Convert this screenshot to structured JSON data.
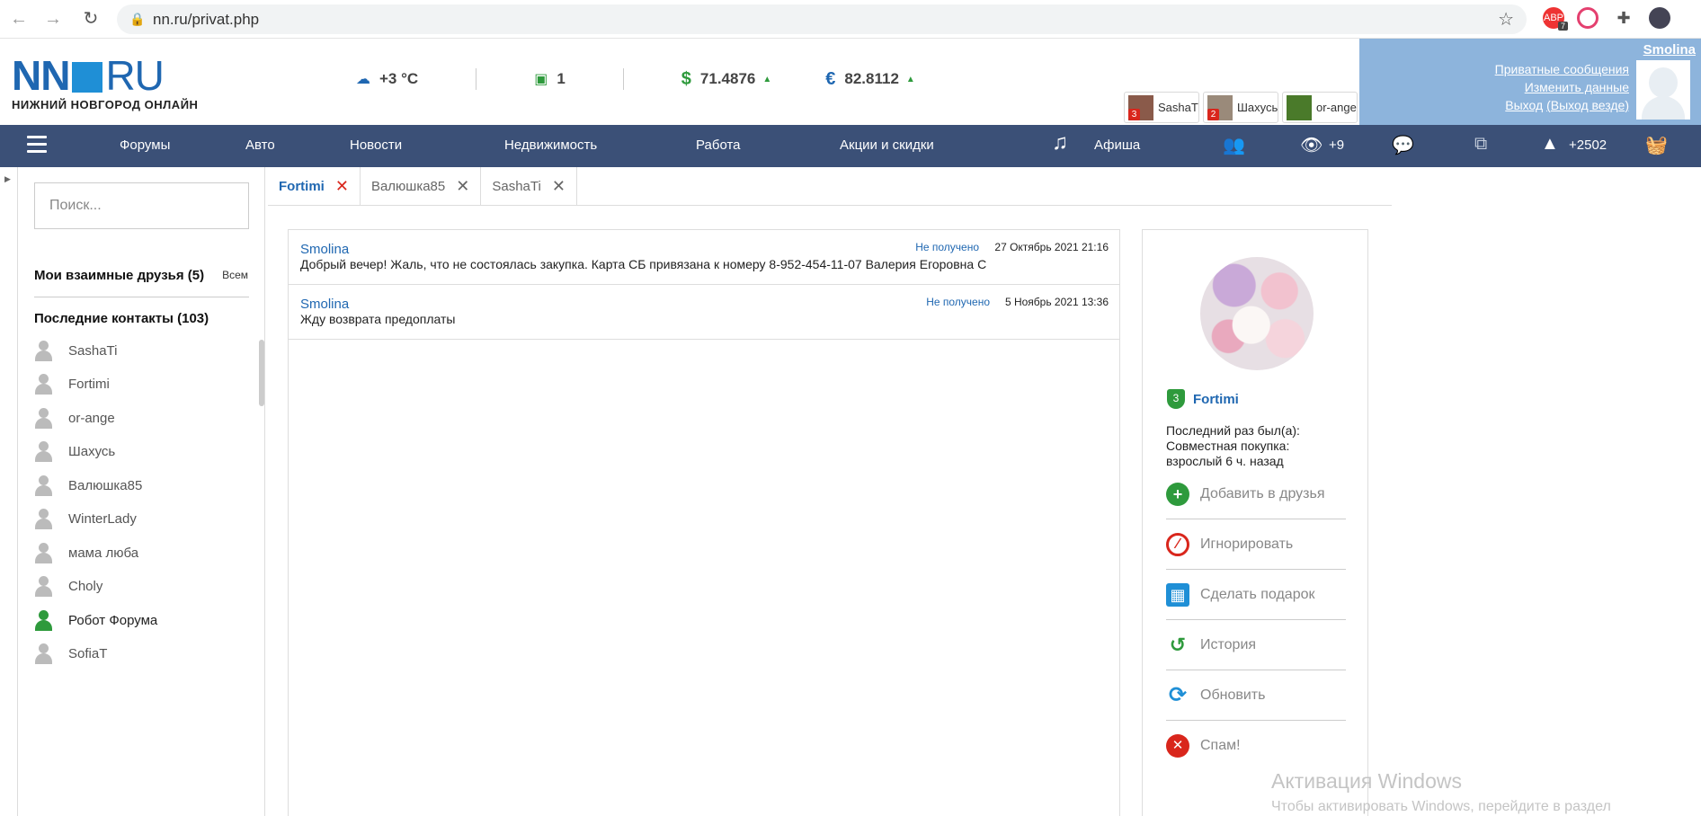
{
  "browser": {
    "url": "nn.ru/privat.php",
    "ext_badge": "7"
  },
  "header": {
    "logo_main": "NN",
    "logo_ru": "RU",
    "logo_sub": "НИЖНИЙ НОВГОРОД ОНЛАЙН",
    "weather": "+3 °C",
    "traffic": "1",
    "usd": "71.4876",
    "eur": "82.8112",
    "open_chats": [
      {
        "name": "SashaTi",
        "badge": "3"
      },
      {
        "name": "Шахусь",
        "badge": "2"
      },
      {
        "name": "or-ange",
        "badge": ""
      }
    ],
    "user": {
      "name": "Smolina",
      "link_messages": "Приватные сообщения",
      "link_edit": "Изменить данные",
      "link_logout": "Выход",
      "link_logout_all": "(Выход везде)"
    }
  },
  "nav": {
    "items": [
      "Форумы",
      "Авто",
      "Новости",
      "Недвижимость",
      "Работа",
      "Акции и скидки",
      "Афиша"
    ],
    "views_count": "+9",
    "rating_count": "+2502"
  },
  "sidebar": {
    "search_placeholder": "Поиск...",
    "friends_title": "Мои взаимные друзья (5)",
    "friends_all": "Всем",
    "contacts_title": "Последние контакты (103)",
    "contacts": [
      {
        "name": "SashaTi",
        "online": false
      },
      {
        "name": "Fortimi",
        "online": false
      },
      {
        "name": "or-ange",
        "online": false
      },
      {
        "name": "Шахусь",
        "online": false
      },
      {
        "name": "Валюшка85",
        "online": false
      },
      {
        "name": "WinterLady",
        "online": false
      },
      {
        "name": "мама люба",
        "online": false
      },
      {
        "name": "Choly",
        "online": false
      },
      {
        "name": "Робот Форума",
        "online": true
      },
      {
        "name": "SofiaT",
        "online": false
      }
    ]
  },
  "tabs": [
    {
      "label": "Fortimi",
      "active": true
    },
    {
      "label": "Валюшка85",
      "active": false
    },
    {
      "label": "SashaTi",
      "active": false
    }
  ],
  "messages": [
    {
      "from": "Smolina",
      "status": "Не получено",
      "date": "27 Октябрь 2021 21:16",
      "text": "Добрый вечер! Жаль, что не состоялась закупка. Карта СБ привязана к номеру 8-952-454-11-07 Валерия Егоровна С"
    },
    {
      "from": "Smolina",
      "status": "Не получено",
      "date": "5 Ноябрь 2021 13:36",
      "text": "Жду возврата предоплаты"
    }
  ],
  "profile": {
    "level": "3",
    "name": "Fortimi",
    "seen_label": "Последний раз был(а):",
    "seen_place": "Совместная покупка:",
    "seen_value": "взрослый 6 ч. назад",
    "actions": [
      {
        "label": "Добавить в друзья",
        "icon": "plus-icon",
        "color": "#2e9a3c"
      },
      {
        "label": "Игнорировать",
        "icon": "block-icon",
        "color": "#d9261c"
      },
      {
        "label": "Сделать подарок",
        "icon": "gift-icon",
        "color": "#1f8fd6"
      },
      {
        "label": "История",
        "icon": "history-icon",
        "color": "#2e9a3c"
      },
      {
        "label": "Обновить",
        "icon": "refresh-icon",
        "color": "#1f8fd6"
      },
      {
        "label": "Спам!",
        "icon": "spam-icon",
        "color": "#d9261c"
      }
    ]
  },
  "watermark": {
    "title": "Активация Windows",
    "text": "Чтобы активировать Windows, перейдите в раздел"
  },
  "colors": {
    "navbar": "#3b5077",
    "user_panel": "#8db4dc",
    "link": "#1f67b1",
    "accent_green": "#2e9a3c",
    "accent_red": "#d9261c"
  }
}
